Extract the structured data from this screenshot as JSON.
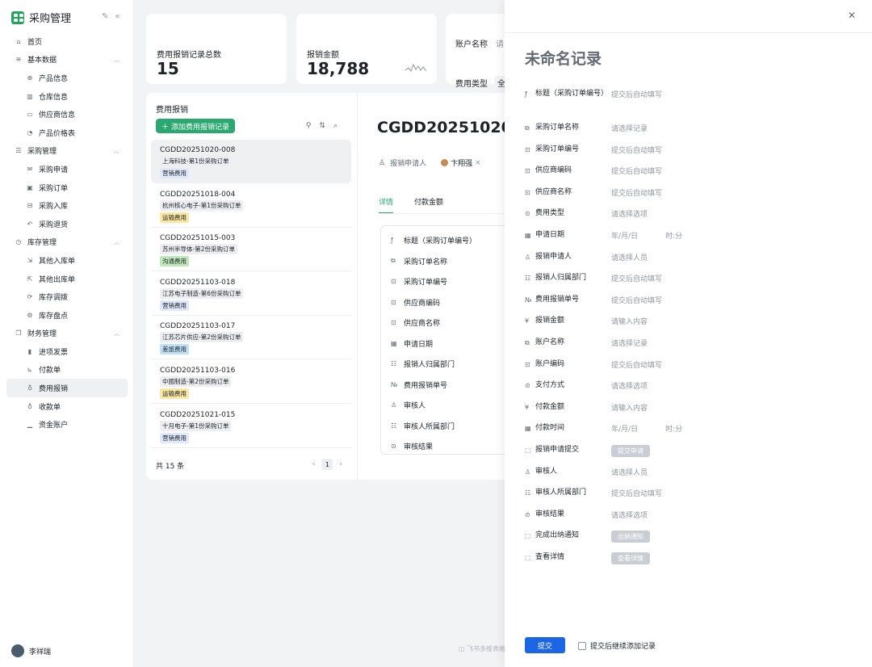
{
  "app": {
    "title": "采购管理"
  },
  "sidebar": {
    "items": [
      {
        "label": "首页",
        "icon": "home-icon",
        "level": 0
      },
      {
        "label": "基本数据",
        "icon": "layers-icon",
        "level": 0,
        "expanded": true
      },
      {
        "label": "产品信息",
        "icon": "globe-icon",
        "level": 1
      },
      {
        "label": "仓库信息",
        "icon": "warehouse-icon",
        "level": 1
      },
      {
        "label": "供应商信息",
        "icon": "monitor-icon",
        "level": 1
      },
      {
        "label": "产品价格表",
        "icon": "price-icon",
        "level": 1
      },
      {
        "label": "采购管理",
        "icon": "database-icon",
        "level": 0,
        "expanded": true
      },
      {
        "label": "采购申请",
        "icon": "mail-icon",
        "level": 1
      },
      {
        "label": "采购订单",
        "icon": "calendar-icon",
        "level": 1
      },
      {
        "label": "采购入库",
        "icon": "inbox-icon",
        "level": 1
      },
      {
        "label": "采购退货",
        "icon": "return-icon",
        "level": 1
      },
      {
        "label": "库存管理",
        "icon": "clock-icon",
        "level": 0,
        "expanded": true
      },
      {
        "label": "其他入库单",
        "icon": "inbound-icon",
        "level": 1
      },
      {
        "label": "其他出库单",
        "icon": "outbound-icon",
        "level": 1
      },
      {
        "label": "库存调拨",
        "icon": "transfer-icon",
        "level": 1
      },
      {
        "label": "库存盘点",
        "icon": "settings-icon",
        "level": 1
      },
      {
        "label": "财务管理",
        "icon": "copy-icon",
        "level": 0,
        "expanded": true
      },
      {
        "label": "进项发票",
        "icon": "barcode-icon",
        "level": 1
      },
      {
        "label": "付款单",
        "icon": "chart-icon",
        "level": 1
      },
      {
        "label": "费用报销",
        "icon": "bulb-icon",
        "level": 1,
        "active": true
      },
      {
        "label": "收款单",
        "icon": "bulb-icon",
        "level": 1
      },
      {
        "label": "资金账户",
        "icon": "bar-chart-icon",
        "level": 1
      }
    ],
    "user": {
      "name": "李祥瑞"
    }
  },
  "stats": [
    {
      "label": "费用报销记录总数",
      "value": "15"
    },
    {
      "label": "报销金额",
      "value": "18,788"
    }
  ],
  "filters": [
    {
      "label": "账户名称",
      "value": "请"
    },
    {
      "label": "费用类型",
      "value": "全"
    }
  ],
  "list": {
    "title": "费用报销",
    "add_label": "添加费用报销记录",
    "records": [
      {
        "id": "CGDD20251020-008",
        "order": "上海科技-第1份采购订单",
        "type": "营销费用",
        "type_color": "#e0e8fb"
      },
      {
        "id": "CGDD20251018-004",
        "order": "杭州核心电子-第1份采购订单",
        "type": "运输费用",
        "type_color": "#fbe7a1"
      },
      {
        "id": "CGDD20251015-003",
        "order": "苏州半导体-第2份采购订单",
        "type": "沟通费用",
        "type_color": "#bfe8b8"
      },
      {
        "id": "CGDD20251103-018",
        "order": "江苏电子制造-第6份采购订单",
        "type": "营销费用",
        "type_color": "#e0e8fb"
      },
      {
        "id": "CGDD20251103-017",
        "order": "江苏芯片供应-第2份采购订单",
        "type": "差旅费用",
        "type_color": "#bfe1f6"
      },
      {
        "id": "CGDD20251103-016",
        "order": "中國制造-第2份采购订单",
        "type": "运输费用",
        "type_color": "#fbe7a1"
      },
      {
        "id": "CGDD20251021-015",
        "order": "十月电子-第1份采购订单",
        "type": "营销费用",
        "type_color": "#e0e8fb"
      }
    ],
    "total": "共 15 条",
    "page": "1"
  },
  "detail": {
    "title": "CGDD20251020-",
    "applicant_label": "报销申请人",
    "applicant": "卞翔强",
    "tabs": [
      "详情",
      "付款金额"
    ],
    "fields": [
      "标题（采购订单编号）",
      "采购订单名称",
      "采购订单编号",
      "供应商编码",
      "供应商名称",
      "申请日期",
      "报销人归属部门",
      "费用报销单号",
      "审核人",
      "审核人所属部门",
      "审核结果"
    ]
  },
  "watermark": "飞书多维表格",
  "drawer": {
    "title": "未命名记录",
    "fields": [
      {
        "label": "标题（采购订单编号）",
        "value": "提交后自动填写",
        "icon": "formula-icon",
        "tall": true
      },
      {
        "label": "采购订单名称",
        "value": "请选择记录",
        "icon": "link-icon"
      },
      {
        "label": "采购订单编号",
        "value": "提交后自动填写",
        "icon": "lookup-icon"
      },
      {
        "label": "供应商编码",
        "value": "提交后自动填写",
        "icon": "lookup-icon"
      },
      {
        "label": "供应商名称",
        "value": "提交后自动填写",
        "icon": "lookup-icon"
      },
      {
        "label": "费用类型",
        "value": "请选择选项",
        "icon": "select-icon"
      },
      {
        "label": "申请日期",
        "value": "年/月/日",
        "time": "时:分",
        "icon": "date-icon"
      },
      {
        "label": "报销申请人",
        "value": "请选择人员",
        "icon": "person-icon"
      },
      {
        "label": "报销人归属部门",
        "value": "提交后自动填写",
        "icon": "dept-icon"
      },
      {
        "label": "费用报销单号",
        "value": "提交后自动填写",
        "icon": "number-icon"
      },
      {
        "label": "报销金额",
        "value": "请输入内容",
        "icon": "currency-icon"
      },
      {
        "label": "账户名称",
        "value": "请选择记录",
        "icon": "link-icon"
      },
      {
        "label": "账户编码",
        "value": "提交后自动填写",
        "icon": "lookup-icon"
      },
      {
        "label": "支付方式",
        "value": "请选择选项",
        "icon": "select-icon"
      },
      {
        "label": "付款金额",
        "value": "请输入内容",
        "icon": "currency-icon"
      },
      {
        "label": "付款时间",
        "value": "年/月/日",
        "time": "时:分",
        "icon": "date-icon"
      },
      {
        "label": "报销申请提交",
        "button": "提交申请",
        "icon": "button-icon"
      },
      {
        "label": "审核人",
        "value": "请选择人员",
        "icon": "person-icon"
      },
      {
        "label": "审核人所属部门",
        "value": "提交后自动填写",
        "icon": "dept-icon"
      },
      {
        "label": "审核结果",
        "value": "请选择选项",
        "icon": "select-icon"
      },
      {
        "label": "完成出纳通知",
        "button": "出纳通知",
        "icon": "button-icon"
      },
      {
        "label": "查看详情",
        "button": "查看详情",
        "icon": "button-icon"
      }
    ],
    "submit_label": "提交",
    "continue_label": "提交后继续添加记录"
  },
  "colors": {
    "accent": "#2aa870",
    "primary": "#1c66e5",
    "sidebar_active": "#eef0f2"
  }
}
